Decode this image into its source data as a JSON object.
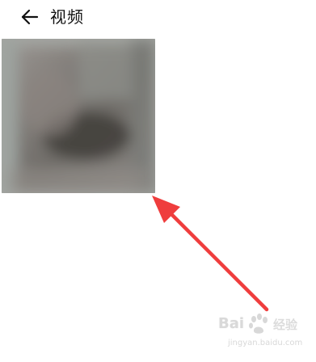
{
  "header": {
    "back_icon": "arrow-left-icon",
    "title": "视频"
  },
  "video_thumbnail": {
    "description_icon": "video-thumbnail"
  },
  "annotation": {
    "arrow_color": "#ef3d3d",
    "arrow_icon": "red-arrow-pointer-icon"
  },
  "watermark": {
    "logo_prefix": "Bai",
    "logo_suffix": "经验",
    "url": "jingyan.baidu.com",
    "color": "#d9d9d9"
  }
}
